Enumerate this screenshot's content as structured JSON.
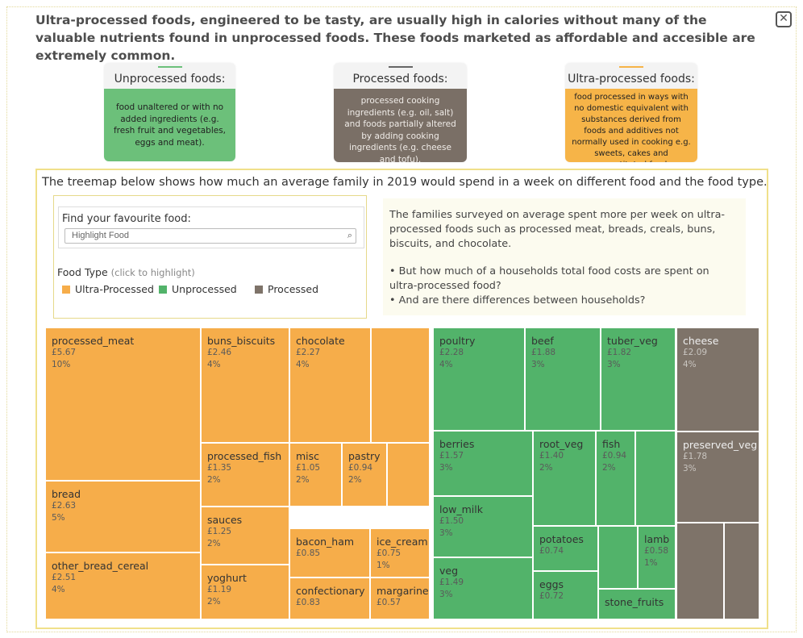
{
  "intro": "Ultra-processed foods, engineered to be tasty, are usually high in calories without many of the valuable nutrients found in unprocessed foods. These foods marketed as affordable and accesible are extremely common.",
  "close_label": "✕",
  "cards": [
    {
      "title": "Unprocessed foods:",
      "body": "food unaltered or with no added ingredients (e.g. fresh fruit and vegetables, eggs and meat).",
      "color": "#6cc07a",
      "accent": "#6cc07a"
    },
    {
      "title": "Processed foods:",
      "body": "processed cooking ingredients (e.g. oil, salt) and foods partially altered by adding cooking ingredients (e.g. cheese and tofu).",
      "color": "#7a6f66",
      "accent": "#666666"
    },
    {
      "title": "Ultra-processed foods:",
      "body": "food processed in ways with no domestic equivalent with substances derived from foods and additives not normally used in cooking e.g. sweets, cakes and reconstituted food.",
      "color": "#f6b448",
      "accent": "#f6b448"
    }
  ],
  "treemap_title": "The treemap below shows how much an average family in 2019 would spend in a week on different food and the food type.",
  "search": {
    "label": "Find  your favourite food:",
    "placeholder": "Highlight Food",
    "icon": "search-icon"
  },
  "food_type": {
    "title": "Food Type",
    "hint": "(click to highlight)",
    "items": [
      {
        "label": "Ultra-Processed",
        "color": "#f6ad4a"
      },
      {
        "label": "Unprocessed",
        "color": "#52b36a"
      },
      {
        "label": "Processed",
        "color": "#7e7369"
      }
    ]
  },
  "note": {
    "para1": "The families surveyed on average spent more per week on ultra-processed foods such as processed meat,  breads, creals, buns, biscuits, and chocolate.",
    "bullet1": "• But how much of a households total food costs are spent on ultra-processed food?",
    "bullet2": "• And are there differences between households?"
  },
  "colors": {
    "ultra": "#f6ad4a",
    "unprocessed": "#52b36a",
    "processed": "#7e7369"
  },
  "tiles": [
    {
      "type": "ultra",
      "name": "processed_meat",
      "price": "£5.67",
      "pct": "10%"
    },
    {
      "type": "ultra",
      "name": "bread",
      "price": "£2.63",
      "pct": "5%"
    },
    {
      "type": "ultra",
      "name": "other_bread_cereal",
      "price": "£2.51",
      "pct": "4%"
    },
    {
      "type": "ultra",
      "name": "buns_biscuits",
      "price": "£2.46",
      "pct": "4%"
    },
    {
      "type": "ultra",
      "name": "chocolate",
      "price": "£2.27",
      "pct": "4%"
    },
    {
      "type": "ultra",
      "name": "",
      "price": "",
      "pct": ""
    },
    {
      "type": "ultra",
      "name": "processed_fish",
      "price": "£1.35",
      "pct": "2%"
    },
    {
      "type": "ultra",
      "name": "misc",
      "price": "£1.05",
      "pct": "2%"
    },
    {
      "type": "ultra",
      "name": "pastry",
      "price": "£0.94",
      "pct": "2%"
    },
    {
      "type": "ultra",
      "name": "",
      "price": "",
      "pct": ""
    },
    {
      "type": "ultra",
      "name": "sauces",
      "price": "£1.25",
      "pct": "2%"
    },
    {
      "type": "ultra",
      "name": "bacon_ham",
      "price": "£0.85",
      "pct": ""
    },
    {
      "type": "ultra",
      "name": "ice_cream",
      "price": "£0.75",
      "pct": "1%"
    },
    {
      "type": "ultra",
      "name": "yoghurt",
      "price": "£1.19",
      "pct": "2%"
    },
    {
      "type": "ultra",
      "name": "confectionary",
      "price": "£0.83",
      "pct": ""
    },
    {
      "type": "ultra",
      "name": "margarine",
      "price": "£0.57",
      "pct": ""
    },
    {
      "type": "unprocessed",
      "name": "poultry",
      "price": "£2.28",
      "pct": "4%"
    },
    {
      "type": "unprocessed",
      "name": "beef",
      "price": "£1.88",
      "pct": "3%"
    },
    {
      "type": "unprocessed",
      "name": "tuber_veg",
      "price": "£1.82",
      "pct": "3%"
    },
    {
      "type": "unprocessed",
      "name": "berries",
      "price": "£1.57",
      "pct": "3%"
    },
    {
      "type": "unprocessed",
      "name": "root_veg",
      "price": "£1.40",
      "pct": "2%"
    },
    {
      "type": "unprocessed",
      "name": "fish",
      "price": "£0.94",
      "pct": "2%"
    },
    {
      "type": "unprocessed",
      "name": "",
      "price": "",
      "pct": ""
    },
    {
      "type": "unprocessed",
      "name": "low_milk",
      "price": "£1.50",
      "pct": "3%"
    },
    {
      "type": "unprocessed",
      "name": "potatoes",
      "price": "£0.74",
      "pct": ""
    },
    {
      "type": "unprocessed",
      "name": "",
      "price": "",
      "pct": ""
    },
    {
      "type": "unprocessed",
      "name": "lamb",
      "price": "£0.58",
      "pct": "1%"
    },
    {
      "type": "unprocessed",
      "name": "veg",
      "price": "£1.49",
      "pct": "3%"
    },
    {
      "type": "unprocessed",
      "name": "eggs",
      "price": "£0.72",
      "pct": ""
    },
    {
      "type": "unprocessed",
      "name": "stone_fruits",
      "price": "",
      "pct": ""
    },
    {
      "type": "processed",
      "name": "cheese",
      "price": "£2.09",
      "pct": "4%"
    },
    {
      "type": "processed",
      "name": "preserved_veg",
      "price": "£1.78",
      "pct": "3%"
    },
    {
      "type": "processed",
      "name": "",
      "price": "",
      "pct": ""
    },
    {
      "type": "processed",
      "name": "",
      "price": "",
      "pct": ""
    }
  ]
}
